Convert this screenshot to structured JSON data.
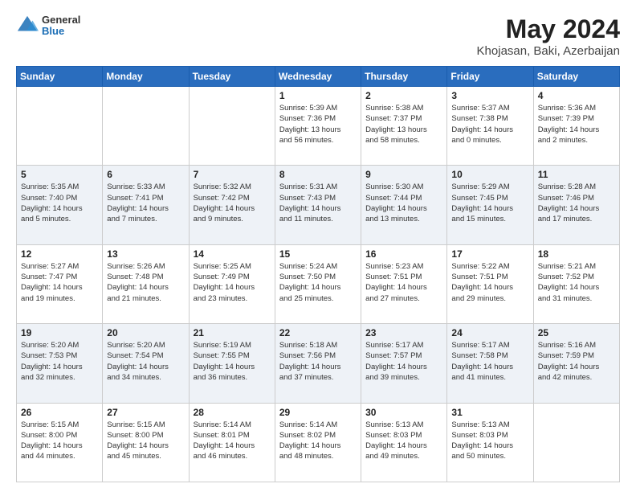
{
  "header": {
    "logo_general": "General",
    "logo_blue": "Blue",
    "main_title": "May 2024",
    "subtitle": "Khojasan, Baki, Azerbaijan"
  },
  "days_of_week": [
    "Sunday",
    "Monday",
    "Tuesday",
    "Wednesday",
    "Thursday",
    "Friday",
    "Saturday"
  ],
  "weeks": [
    [
      {
        "num": "",
        "lines": []
      },
      {
        "num": "",
        "lines": []
      },
      {
        "num": "",
        "lines": []
      },
      {
        "num": "1",
        "lines": [
          "Sunrise: 5:39 AM",
          "Sunset: 7:36 PM",
          "Daylight: 13 hours",
          "and 56 minutes."
        ]
      },
      {
        "num": "2",
        "lines": [
          "Sunrise: 5:38 AM",
          "Sunset: 7:37 PM",
          "Daylight: 13 hours",
          "and 58 minutes."
        ]
      },
      {
        "num": "3",
        "lines": [
          "Sunrise: 5:37 AM",
          "Sunset: 7:38 PM",
          "Daylight: 14 hours",
          "and 0 minutes."
        ]
      },
      {
        "num": "4",
        "lines": [
          "Sunrise: 5:36 AM",
          "Sunset: 7:39 PM",
          "Daylight: 14 hours",
          "and 2 minutes."
        ]
      }
    ],
    [
      {
        "num": "5",
        "lines": [
          "Sunrise: 5:35 AM",
          "Sunset: 7:40 PM",
          "Daylight: 14 hours",
          "and 5 minutes."
        ]
      },
      {
        "num": "6",
        "lines": [
          "Sunrise: 5:33 AM",
          "Sunset: 7:41 PM",
          "Daylight: 14 hours",
          "and 7 minutes."
        ]
      },
      {
        "num": "7",
        "lines": [
          "Sunrise: 5:32 AM",
          "Sunset: 7:42 PM",
          "Daylight: 14 hours",
          "and 9 minutes."
        ]
      },
      {
        "num": "8",
        "lines": [
          "Sunrise: 5:31 AM",
          "Sunset: 7:43 PM",
          "Daylight: 14 hours",
          "and 11 minutes."
        ]
      },
      {
        "num": "9",
        "lines": [
          "Sunrise: 5:30 AM",
          "Sunset: 7:44 PM",
          "Daylight: 14 hours",
          "and 13 minutes."
        ]
      },
      {
        "num": "10",
        "lines": [
          "Sunrise: 5:29 AM",
          "Sunset: 7:45 PM",
          "Daylight: 14 hours",
          "and 15 minutes."
        ]
      },
      {
        "num": "11",
        "lines": [
          "Sunrise: 5:28 AM",
          "Sunset: 7:46 PM",
          "Daylight: 14 hours",
          "and 17 minutes."
        ]
      }
    ],
    [
      {
        "num": "12",
        "lines": [
          "Sunrise: 5:27 AM",
          "Sunset: 7:47 PM",
          "Daylight: 14 hours",
          "and 19 minutes."
        ]
      },
      {
        "num": "13",
        "lines": [
          "Sunrise: 5:26 AM",
          "Sunset: 7:48 PM",
          "Daylight: 14 hours",
          "and 21 minutes."
        ]
      },
      {
        "num": "14",
        "lines": [
          "Sunrise: 5:25 AM",
          "Sunset: 7:49 PM",
          "Daylight: 14 hours",
          "and 23 minutes."
        ]
      },
      {
        "num": "15",
        "lines": [
          "Sunrise: 5:24 AM",
          "Sunset: 7:50 PM",
          "Daylight: 14 hours",
          "and 25 minutes."
        ]
      },
      {
        "num": "16",
        "lines": [
          "Sunrise: 5:23 AM",
          "Sunset: 7:51 PM",
          "Daylight: 14 hours",
          "and 27 minutes."
        ]
      },
      {
        "num": "17",
        "lines": [
          "Sunrise: 5:22 AM",
          "Sunset: 7:51 PM",
          "Daylight: 14 hours",
          "and 29 minutes."
        ]
      },
      {
        "num": "18",
        "lines": [
          "Sunrise: 5:21 AM",
          "Sunset: 7:52 PM",
          "Daylight: 14 hours",
          "and 31 minutes."
        ]
      }
    ],
    [
      {
        "num": "19",
        "lines": [
          "Sunrise: 5:20 AM",
          "Sunset: 7:53 PM",
          "Daylight: 14 hours",
          "and 32 minutes."
        ]
      },
      {
        "num": "20",
        "lines": [
          "Sunrise: 5:20 AM",
          "Sunset: 7:54 PM",
          "Daylight: 14 hours",
          "and 34 minutes."
        ]
      },
      {
        "num": "21",
        "lines": [
          "Sunrise: 5:19 AM",
          "Sunset: 7:55 PM",
          "Daylight: 14 hours",
          "and 36 minutes."
        ]
      },
      {
        "num": "22",
        "lines": [
          "Sunrise: 5:18 AM",
          "Sunset: 7:56 PM",
          "Daylight: 14 hours",
          "and 37 minutes."
        ]
      },
      {
        "num": "23",
        "lines": [
          "Sunrise: 5:17 AM",
          "Sunset: 7:57 PM",
          "Daylight: 14 hours",
          "and 39 minutes."
        ]
      },
      {
        "num": "24",
        "lines": [
          "Sunrise: 5:17 AM",
          "Sunset: 7:58 PM",
          "Daylight: 14 hours",
          "and 41 minutes."
        ]
      },
      {
        "num": "25",
        "lines": [
          "Sunrise: 5:16 AM",
          "Sunset: 7:59 PM",
          "Daylight: 14 hours",
          "and 42 minutes."
        ]
      }
    ],
    [
      {
        "num": "26",
        "lines": [
          "Sunrise: 5:15 AM",
          "Sunset: 8:00 PM",
          "Daylight: 14 hours",
          "and 44 minutes."
        ]
      },
      {
        "num": "27",
        "lines": [
          "Sunrise: 5:15 AM",
          "Sunset: 8:00 PM",
          "Daylight: 14 hours",
          "and 45 minutes."
        ]
      },
      {
        "num": "28",
        "lines": [
          "Sunrise: 5:14 AM",
          "Sunset: 8:01 PM",
          "Daylight: 14 hours",
          "and 46 minutes."
        ]
      },
      {
        "num": "29",
        "lines": [
          "Sunrise: 5:14 AM",
          "Sunset: 8:02 PM",
          "Daylight: 14 hours",
          "and 48 minutes."
        ]
      },
      {
        "num": "30",
        "lines": [
          "Sunrise: 5:13 AM",
          "Sunset: 8:03 PM",
          "Daylight: 14 hours",
          "and 49 minutes."
        ]
      },
      {
        "num": "31",
        "lines": [
          "Sunrise: 5:13 AM",
          "Sunset: 8:03 PM",
          "Daylight: 14 hours",
          "and 50 minutes."
        ]
      },
      {
        "num": "",
        "lines": []
      }
    ]
  ]
}
